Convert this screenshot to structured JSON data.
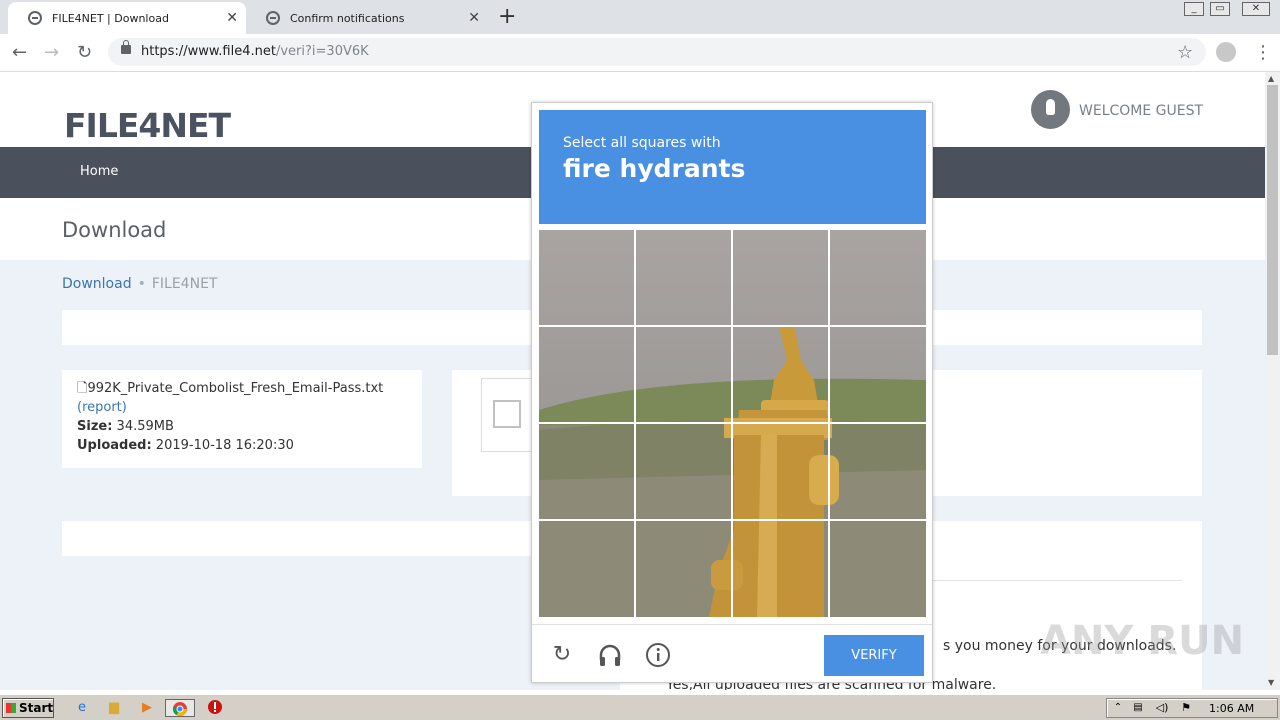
{
  "browser": {
    "tabs": [
      {
        "title": "FILE4NET | Download",
        "active": true
      },
      {
        "title": "Confirm notifications",
        "active": false
      }
    ],
    "url_host": "https://www.file4.net",
    "url_path": "/veri?i=30V6K"
  },
  "site": {
    "logo": "FILE4NET",
    "welcome": "WELCOME GUEST",
    "nav_home": "Home",
    "page_title": "Download",
    "breadcrumb": {
      "link": "Download",
      "separator": "•",
      "current": "FILE4NET"
    },
    "file": {
      "name": "992K_Private_Combolist_Fresh_Email-Pass.txt",
      "report": "(report)",
      "size_label": "Size:",
      "size": "34.59MB",
      "uploaded_label": "Uploaded:",
      "uploaded": "2019-10-18 16:20:30"
    },
    "body_text_1": "s you money for your downloads.",
    "body_text_2": "Yes,All uploaded files are scanned for malware."
  },
  "captcha": {
    "instruction": "Select all squares with",
    "target": "fire hydrants",
    "verify_label": "VERIFY",
    "header_color": "#4a90e2"
  },
  "taskbar": {
    "start_label": "Start",
    "clock": "1:06 AM"
  },
  "watermark": "ANY RUN"
}
